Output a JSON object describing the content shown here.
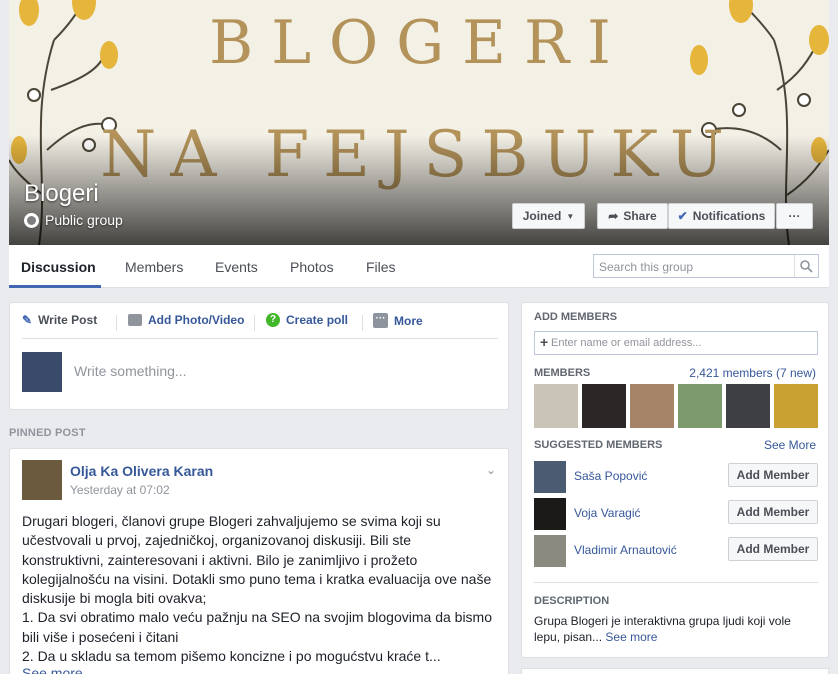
{
  "cover": {
    "line1": "BLOGERI",
    "line2": "NA FEJSBUKU",
    "group_name": "Blogeri",
    "group_type": "Public group",
    "buttons": {
      "joined": "Joined",
      "share": "Share",
      "notifications": "Notifications",
      "more": "···"
    }
  },
  "tabs": {
    "items": [
      "Discussion",
      "Members",
      "Events",
      "Photos",
      "Files"
    ],
    "active": "Discussion",
    "search_placeholder": "Search this group"
  },
  "composer": {
    "write_post": "Write Post",
    "add_photo": "Add Photo/Video",
    "create_poll": "Create poll",
    "more": "More",
    "placeholder": "Write something..."
  },
  "pinned_label": "PINNED POST",
  "post": {
    "author": "Olja Ka Olivera Karan",
    "time": "Yesterday at 07:02",
    "lines": [
      "Drugari blogeri, članovi grupe Blogeri zahvaljujemo se svima koji su",
      "učestvovali u prvoj, zajedničkoj, organizovanoj diskusiji. Bili ste",
      "konstruktivni, zainteresovani i aktivni. Bilo je zanimljivo i prožeto",
      "kolegijalnošću na visini. Dotakli smo puno tema i kratka evaluacija ove naše",
      "diskusije bi mogla biti ovakva;",
      "1. Da svi obratimo malo veću pažnju na SEO na svojim blogovima da bismo",
      "bili više i posećeni i čitani",
      "2. Da u skladu sa temom pišemo koncizne i po mogućstvu kraće t..."
    ],
    "see_more": "See more"
  },
  "sidebar": {
    "add_members_title": "ADD MEMBERS",
    "add_members_placeholder": "Enter name or email address...",
    "members_title": "MEMBERS",
    "members_count": "2,421 members (7 new)",
    "suggested_title": "SUGGESTED MEMBERS",
    "see_more": "See More",
    "suggested": [
      {
        "name": "Saša Popović",
        "button": "Add Member"
      },
      {
        "name": "Voja Varagić",
        "button": "Add Member"
      },
      {
        "name": "Vladimir Arnautović",
        "button": "Add Member"
      }
    ],
    "description_title": "DESCRIPTION",
    "description_line1": "Grupa Blogeri je interaktivna grupa ljudi koji vole",
    "description_line2": "lepu, pisan...",
    "description_more": "See more"
  },
  "colors": {
    "accent": "#4267b2",
    "link": "#365899",
    "cover_text": "#b3935a"
  }
}
